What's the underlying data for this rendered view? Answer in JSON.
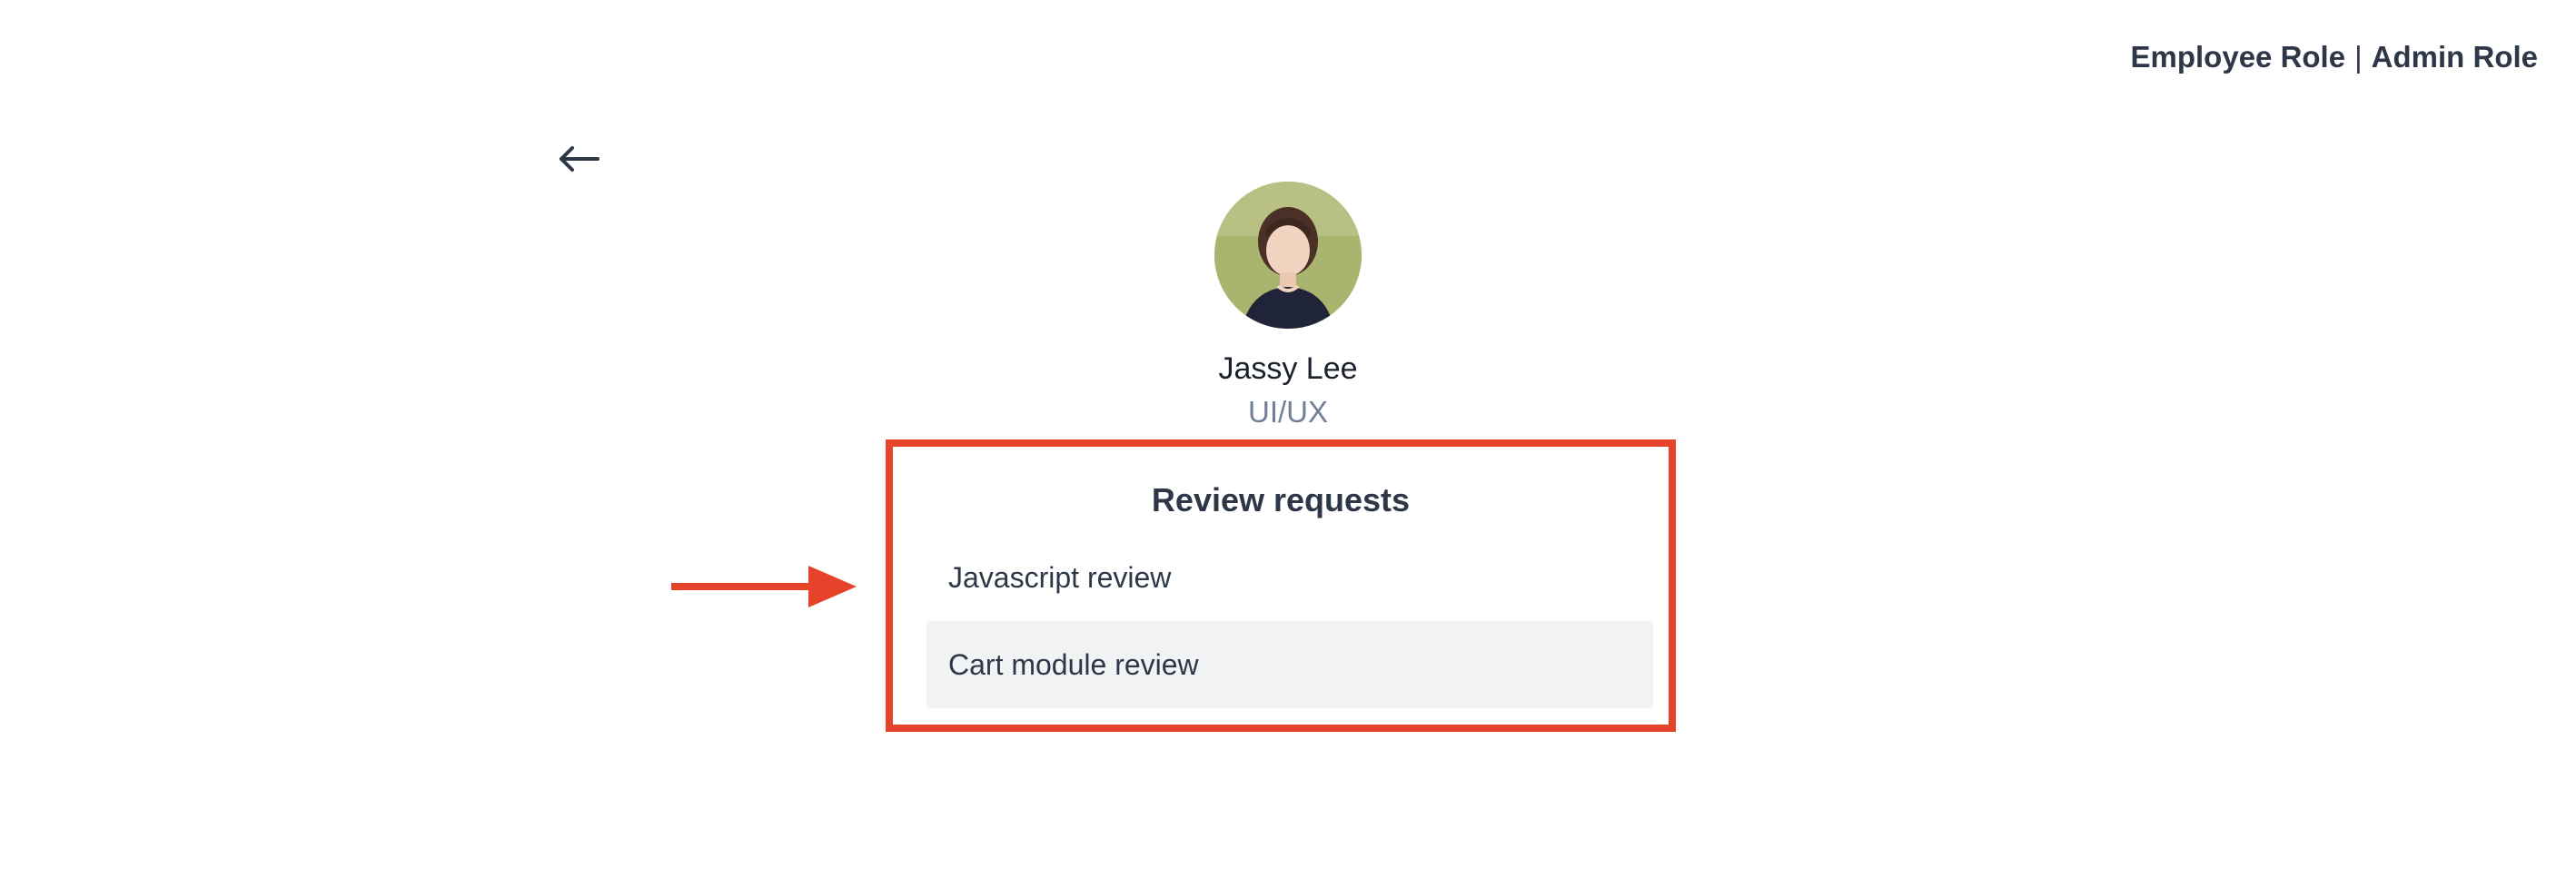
{
  "header": {
    "employee_role_label": "Employee Role",
    "separator": "|",
    "admin_role_label": "Admin Role"
  },
  "navigation": {
    "back_icon": "arrow-left-icon"
  },
  "profile": {
    "name": "Jassy Lee",
    "role": "UI/UX"
  },
  "review_requests": {
    "title": "Review requests",
    "items": [
      {
        "label": "Javascript review",
        "highlighted": false
      },
      {
        "label": "Cart module review",
        "highlighted": true
      }
    ]
  },
  "annotation": {
    "color": "#e6432b",
    "pointer_icon": "arrow-right-icon"
  }
}
